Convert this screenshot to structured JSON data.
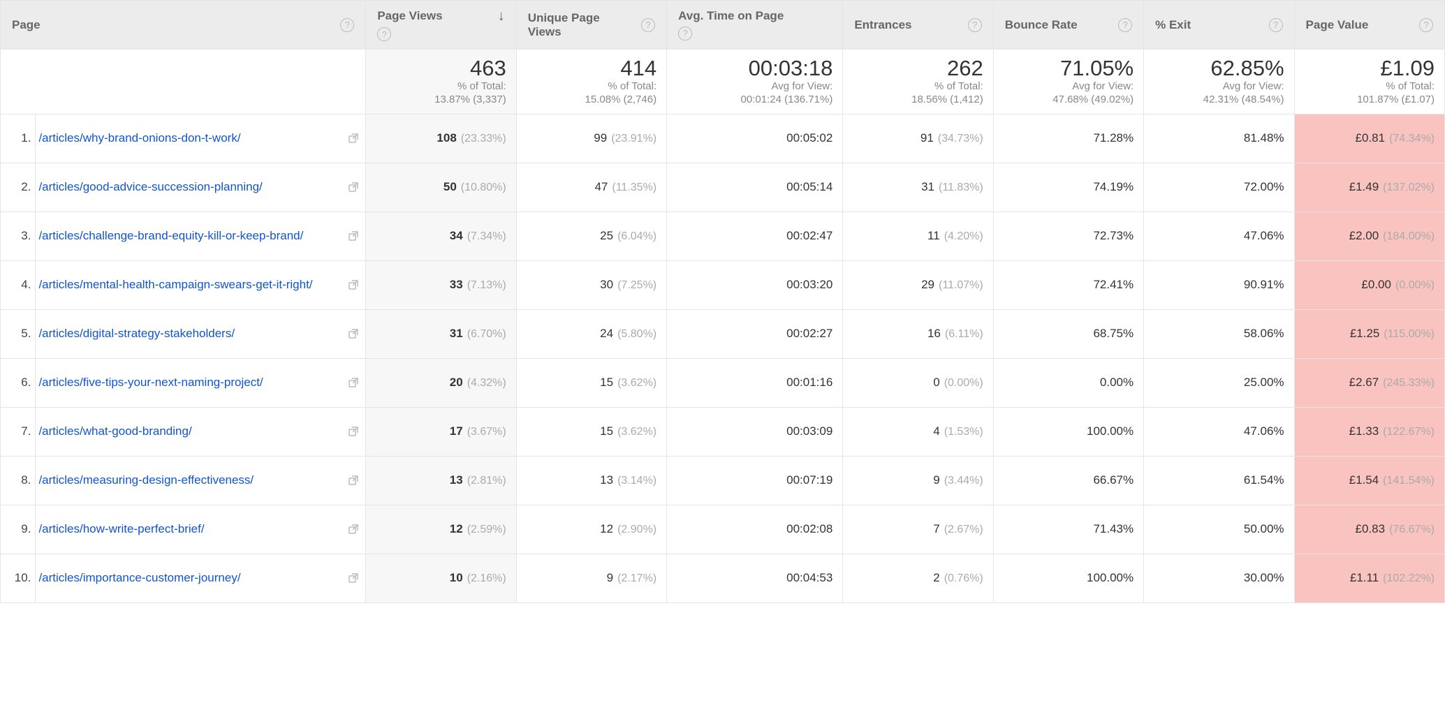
{
  "columns": {
    "page": "Page",
    "pageviews": "Page Views",
    "unique": "Unique Page Views",
    "avgtime": "Avg. Time on Page",
    "entrances": "Entrances",
    "bounce": "Bounce Rate",
    "exit": "% Exit",
    "value": "Page Value"
  },
  "summary": {
    "pageviews": {
      "value": "463",
      "sub1": "% of Total:",
      "sub2": "13.87% (3,337)"
    },
    "unique": {
      "value": "414",
      "sub1": "% of Total:",
      "sub2": "15.08% (2,746)"
    },
    "avgtime": {
      "value": "00:03:18",
      "sub1": "Avg for View:",
      "sub2": "00:01:24 (136.71%)"
    },
    "entrances": {
      "value": "262",
      "sub1": "% of Total:",
      "sub2": "18.56% (1,412)"
    },
    "bounce": {
      "value": "71.05%",
      "sub1": "Avg for View:",
      "sub2": "47.68% (49.02%)"
    },
    "exit": {
      "value": "62.85%",
      "sub1": "Avg for View:",
      "sub2": "42.31% (48.54%)"
    },
    "value": {
      "value": "£1.09",
      "sub1": "% of Total:",
      "sub2": "101.87% (£1.07)"
    }
  },
  "rows": [
    {
      "idx": "1.",
      "page": "/articles/why-brand-onions-don-t-work/",
      "pageviews": {
        "v": "108",
        "p": "(23.33%)"
      },
      "unique": {
        "v": "99",
        "p": "(23.91%)"
      },
      "avgtime": "00:05:02",
      "entrances": {
        "v": "91",
        "p": "(34.73%)"
      },
      "bounce": "71.28%",
      "exit": "81.48%",
      "value": {
        "v": "£0.81",
        "p": "(74.34%)"
      }
    },
    {
      "idx": "2.",
      "page": "/articles/good-advice-succession-planning/",
      "pageviews": {
        "v": "50",
        "p": "(10.80%)"
      },
      "unique": {
        "v": "47",
        "p": "(11.35%)"
      },
      "avgtime": "00:05:14",
      "entrances": {
        "v": "31",
        "p": "(11.83%)"
      },
      "bounce": "74.19%",
      "exit": "72.00%",
      "value": {
        "v": "£1.49",
        "p": "(137.02%)"
      }
    },
    {
      "idx": "3.",
      "page": "/articles/challenge-brand-equity-kill-or-keep-brand/",
      "pageviews": {
        "v": "34",
        "p": "(7.34%)"
      },
      "unique": {
        "v": "25",
        "p": "(6.04%)"
      },
      "avgtime": "00:02:47",
      "entrances": {
        "v": "11",
        "p": "(4.20%)"
      },
      "bounce": "72.73%",
      "exit": "47.06%",
      "value": {
        "v": "£2.00",
        "p": "(184.00%)"
      }
    },
    {
      "idx": "4.",
      "page": "/articles/mental-health-campaign-swears-get-it-right/",
      "pageviews": {
        "v": "33",
        "p": "(7.13%)"
      },
      "unique": {
        "v": "30",
        "p": "(7.25%)"
      },
      "avgtime": "00:03:20",
      "entrances": {
        "v": "29",
        "p": "(11.07%)"
      },
      "bounce": "72.41%",
      "exit": "90.91%",
      "value": {
        "v": "£0.00",
        "p": "(0.00%)"
      }
    },
    {
      "idx": "5.",
      "page": "/articles/digital-strategy-stakeholders/",
      "pageviews": {
        "v": "31",
        "p": "(6.70%)"
      },
      "unique": {
        "v": "24",
        "p": "(5.80%)"
      },
      "avgtime": "00:02:27",
      "entrances": {
        "v": "16",
        "p": "(6.11%)"
      },
      "bounce": "68.75%",
      "exit": "58.06%",
      "value": {
        "v": "£1.25",
        "p": "(115.00%)"
      }
    },
    {
      "idx": "6.",
      "page": "/articles/five-tips-your-next-naming-project/",
      "pageviews": {
        "v": "20",
        "p": "(4.32%)"
      },
      "unique": {
        "v": "15",
        "p": "(3.62%)"
      },
      "avgtime": "00:01:16",
      "entrances": {
        "v": "0",
        "p": "(0.00%)"
      },
      "bounce": "0.00%",
      "exit": "25.00%",
      "value": {
        "v": "£2.67",
        "p": "(245.33%)"
      }
    },
    {
      "idx": "7.",
      "page": "/articles/what-good-branding/",
      "pageviews": {
        "v": "17",
        "p": "(3.67%)"
      },
      "unique": {
        "v": "15",
        "p": "(3.62%)"
      },
      "avgtime": "00:03:09",
      "entrances": {
        "v": "4",
        "p": "(1.53%)"
      },
      "bounce": "100.00%",
      "exit": "47.06%",
      "value": {
        "v": "£1.33",
        "p": "(122.67%)"
      }
    },
    {
      "idx": "8.",
      "page": "/articles/measuring-design-effectiveness/",
      "pageviews": {
        "v": "13",
        "p": "(2.81%)"
      },
      "unique": {
        "v": "13",
        "p": "(3.14%)"
      },
      "avgtime": "00:07:19",
      "entrances": {
        "v": "9",
        "p": "(3.44%)"
      },
      "bounce": "66.67%",
      "exit": "61.54%",
      "value": {
        "v": "£1.54",
        "p": "(141.54%)"
      }
    },
    {
      "idx": "9.",
      "page": "/articles/how-write-perfect-brief/",
      "pageviews": {
        "v": "12",
        "p": "(2.59%)"
      },
      "unique": {
        "v": "12",
        "p": "(2.90%)"
      },
      "avgtime": "00:02:08",
      "entrances": {
        "v": "7",
        "p": "(2.67%)"
      },
      "bounce": "71.43%",
      "exit": "50.00%",
      "value": {
        "v": "£0.83",
        "p": "(76.67%)"
      }
    },
    {
      "idx": "10.",
      "page": "/articles/importance-customer-journey/",
      "pageviews": {
        "v": "10",
        "p": "(2.16%)"
      },
      "unique": {
        "v": "9",
        "p": "(2.17%)"
      },
      "avgtime": "00:04:53",
      "entrances": {
        "v": "2",
        "p": "(0.76%)"
      },
      "bounce": "100.00%",
      "exit": "30.00%",
      "value": {
        "v": "£1.11",
        "p": "(102.22%)"
      }
    }
  ]
}
